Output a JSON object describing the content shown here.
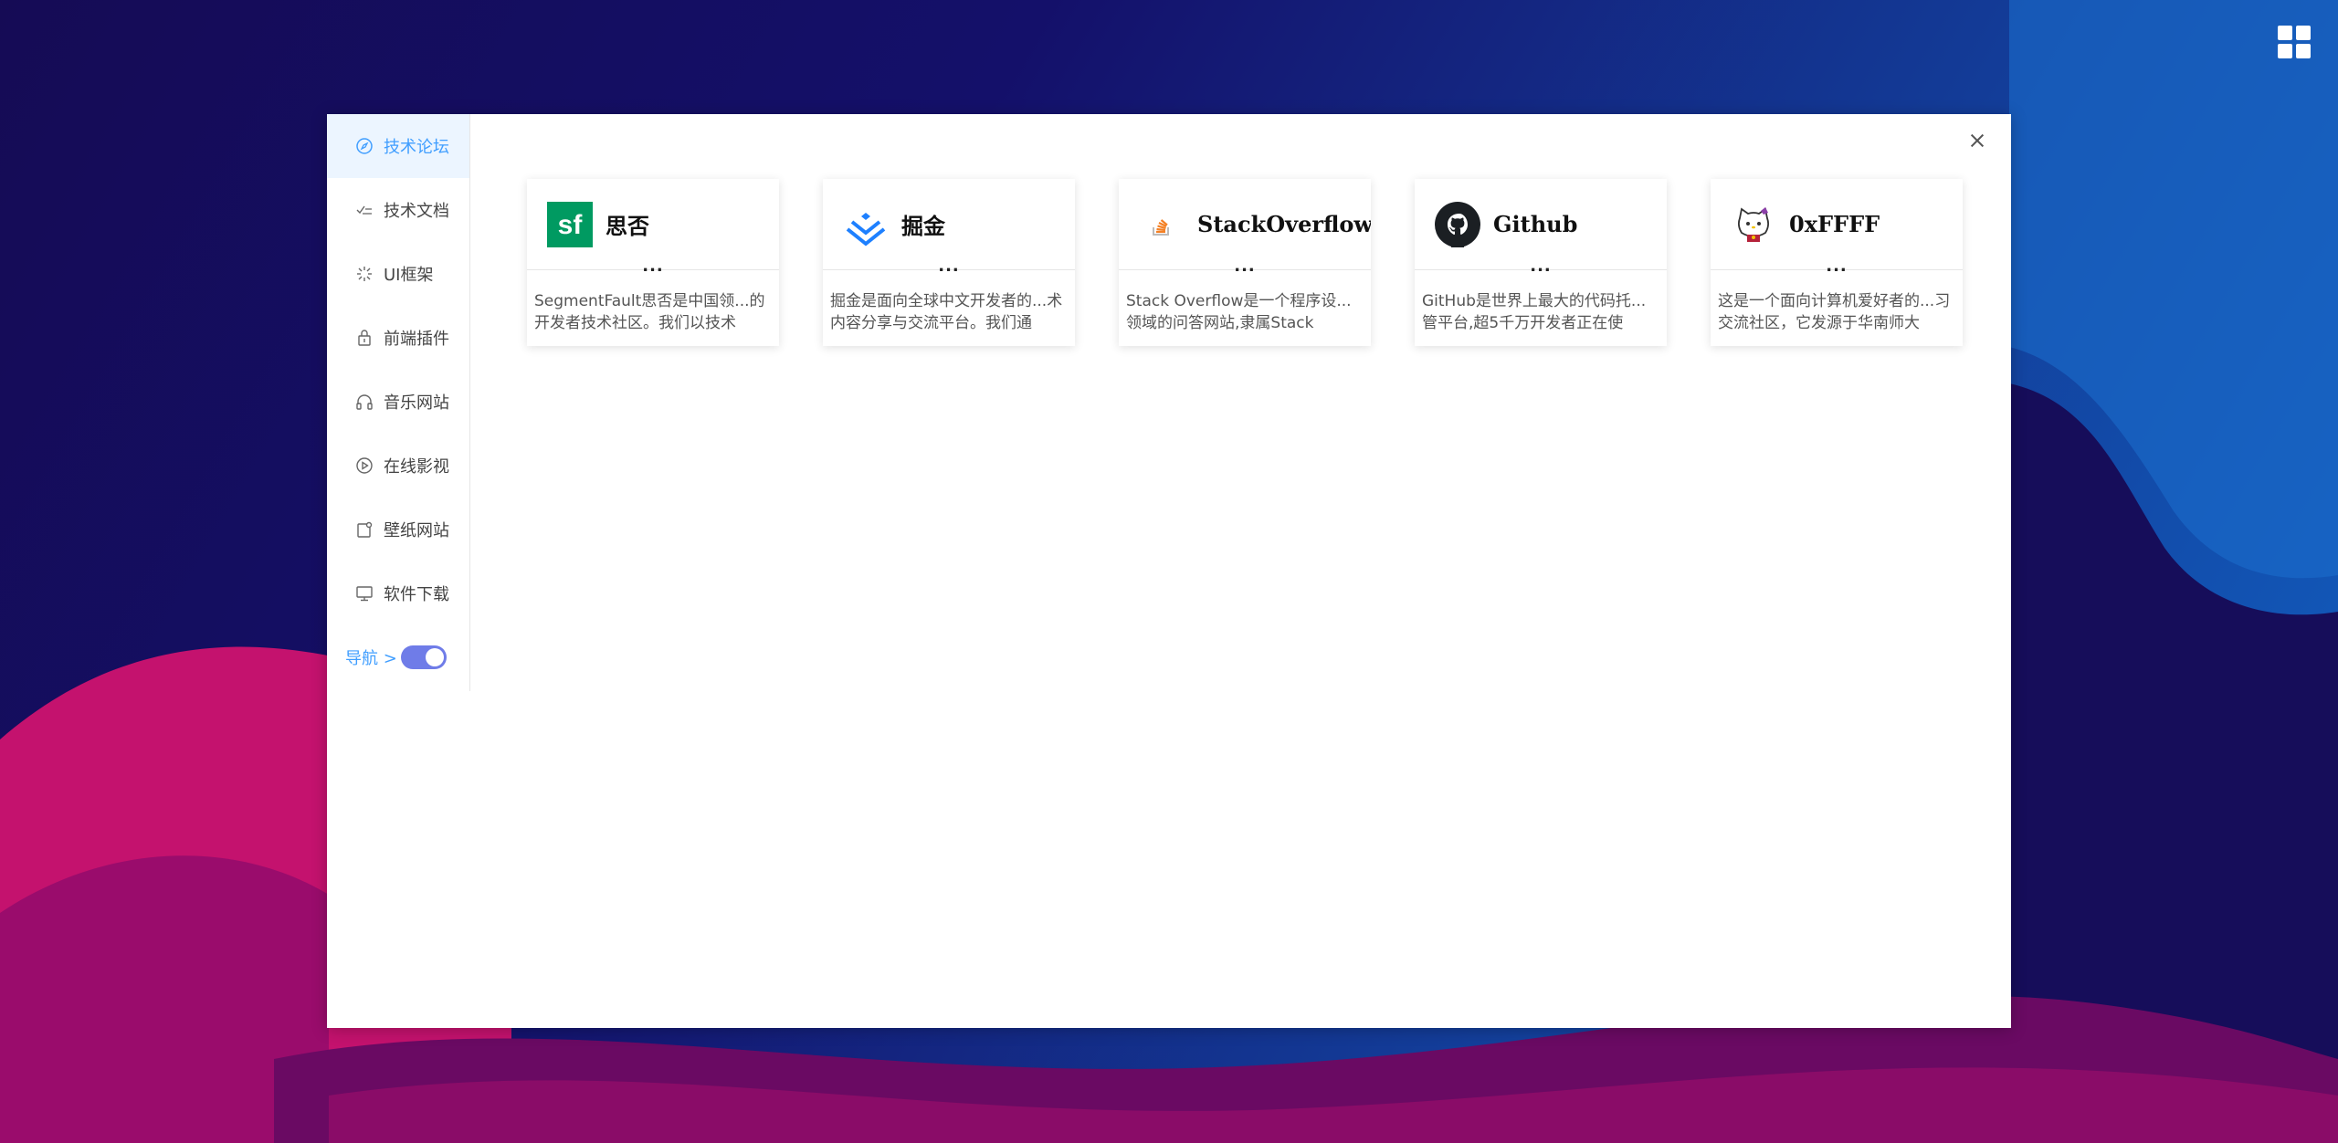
{
  "colors": {
    "accent": "#409eff",
    "toggle": "#6f7ce8",
    "background_dark": "#150b55",
    "background_blue": "#1162c4",
    "wave_pink": "#c4126e",
    "wave_purple": "#7a0a6b"
  },
  "top_right": {
    "icon": "grid-icon"
  },
  "sidebar": {
    "items": [
      {
        "label": "技术论坛",
        "icon": "compass-icon",
        "active": true
      },
      {
        "label": "技术文档",
        "icon": "doc-check-icon",
        "active": false
      },
      {
        "label": "UI框架",
        "icon": "loading-icon",
        "active": false
      },
      {
        "label": "前端插件",
        "icon": "plugin-icon",
        "active": false
      },
      {
        "label": "音乐网站",
        "icon": "headphones-icon",
        "active": false
      },
      {
        "label": "在线影视",
        "icon": "play-circle-icon",
        "active": false
      },
      {
        "label": "壁纸网站",
        "icon": "wallpaper-icon",
        "active": false
      },
      {
        "label": "软件下载",
        "icon": "monitor-icon",
        "active": false
      }
    ],
    "nav_label": "导航 >",
    "nav_toggle_on": true
  },
  "cards": [
    {
      "title": "思否",
      "logo": "segmentfault-logo",
      "dots": "...",
      "desc": "SegmentFault思否是中国领...的开发者技术社区。我们以技术"
    },
    {
      "title": "掘金",
      "logo": "juejin-logo",
      "dots": "...",
      "desc": "掘金是面向全球中文开发者的...术内容分享与交流平台。我们通"
    },
    {
      "title": "StackOverflow",
      "logo": "stackoverflow-logo",
      "dots": "...",
      "desc": "Stack Overflow是一个程序设...领域的问答网站,隶属Stack"
    },
    {
      "title": "Github",
      "logo": "github-logo",
      "dots": "...",
      "desc": "GitHub是世界上最大的代码托...管平台,超5千万开发者正在使"
    },
    {
      "title": "0xFFFF",
      "logo": "0xffff-logo",
      "dots": "...",
      "desc": "这是一个面向计算机爱好者的...习交流社区，它发源于华南师大"
    }
  ]
}
